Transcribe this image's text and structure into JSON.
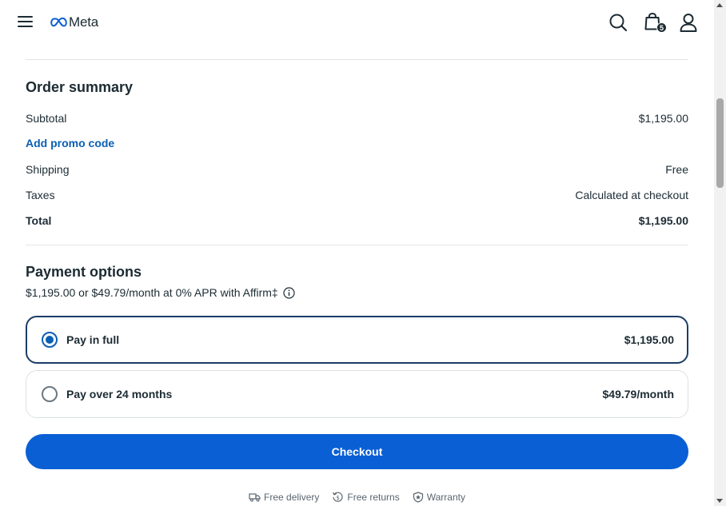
{
  "header": {
    "brand": "Meta",
    "cart_count": "5",
    "icons": [
      "menu-icon",
      "meta-logo",
      "search-icon",
      "shopping-bag-icon",
      "account-icon"
    ]
  },
  "order_summary": {
    "title": "Order summary",
    "subtotal_label": "Subtotal",
    "subtotal_value": "$1,195.00",
    "promo_label": "Add promo code",
    "shipping_label": "Shipping",
    "shipping_value": "Free",
    "taxes_label": "Taxes",
    "taxes_value": "Calculated at checkout",
    "total_label": "Total",
    "total_value": "$1,195.00"
  },
  "payment": {
    "title": "Payment options",
    "apr_text": "$1,195.00 or $49.79/month at 0% APR with Affirm‡",
    "options": [
      {
        "label": "Pay in full",
        "price": "$1,195.00",
        "selected": true
      },
      {
        "label": "Pay over 24 months",
        "price": "$49.79/month",
        "selected": false
      }
    ]
  },
  "checkout": {
    "label": "Checkout"
  },
  "perks": {
    "delivery": "Free delivery",
    "returns": "Free returns",
    "warranty": "Warranty"
  },
  "colors": {
    "accent": "#0a5fd4",
    "link": "#0a5fb4",
    "text": "#1c2b33",
    "selected_border": "#1c3c67"
  }
}
